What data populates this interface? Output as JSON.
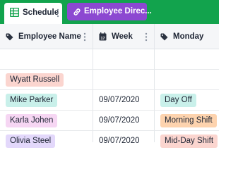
{
  "tabs": [
    {
      "label": "Schedule",
      "icon": "grid-icon",
      "active": true
    },
    {
      "label": "Employee Direc...",
      "icon": "link-icon",
      "active": false
    }
  ],
  "columns": [
    {
      "label": "Employee Name",
      "icon": "tag-icon"
    },
    {
      "label": "Week",
      "icon": "calendar-icon"
    },
    {
      "label": "Monday",
      "icon": "tag-icon"
    }
  ],
  "rows": [
    {
      "employee": "",
      "week": "",
      "monday": ""
    },
    {
      "employee": "Wyatt Russell",
      "week": "",
      "monday": ""
    },
    {
      "employee": "Mike Parker",
      "week": "09/07/2020",
      "monday": "Day Off"
    },
    {
      "employee": "Karla Johen",
      "week": "09/07/2020",
      "monday": "Morning Shift"
    },
    {
      "employee": "Olivia Steel",
      "week": "09/07/2020",
      "monday": "Mid-Day Shift"
    }
  ],
  "colors": {
    "tabbar": "#12a34d",
    "tab_other": "#8c48d1",
    "pill_wyatt": "#fbd5cf",
    "pill_mike": "#c9f0ea",
    "pill_karla": "#f6d6f3",
    "pill_olivia": "#e3d8fb",
    "pill_dayoff": "#c9f0ea",
    "pill_morning": "#fdd3ae",
    "pill_midday": "#fbd5cf"
  },
  "calendar_icon_day": "17"
}
